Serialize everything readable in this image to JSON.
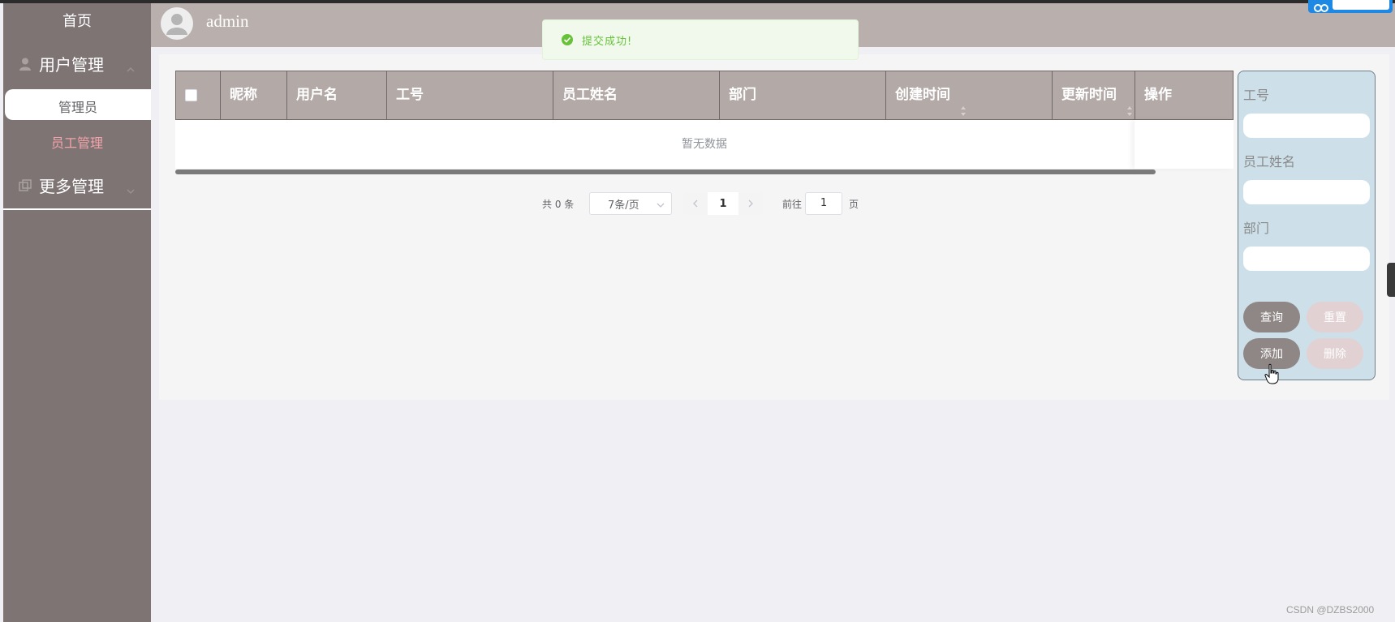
{
  "header": {
    "username": "admin"
  },
  "sidebar": {
    "home": "首页",
    "groups": [
      {
        "label": "用户管理",
        "items": [
          "管理员",
          "员工管理"
        ]
      },
      {
        "label": "更多管理"
      }
    ]
  },
  "toast": {
    "message": "提交成功!"
  },
  "table": {
    "columns": [
      "昵称",
      "用户名",
      "工号",
      "员工姓名",
      "部门",
      "创建时间",
      "更新时间",
      "操作"
    ],
    "empty_text": "暂无数据"
  },
  "pagination": {
    "total": "共 0 条",
    "page_size": "7条/页",
    "current_page": "1",
    "goto_label": "前往",
    "goto_value": "1",
    "goto_unit": "页"
  },
  "search": {
    "labels": [
      "工号",
      "员工姓名",
      "部门"
    ],
    "buttons": {
      "query": "查询",
      "reset": "重置",
      "add": "添加",
      "delete": "删除"
    }
  },
  "watermark": "CSDN @DZBS2000",
  "colors": {
    "sidebar": "#7e7474",
    "header": "#b9afac",
    "table_header": "#b3a9a6",
    "search_panel": "#cde0ea",
    "button_dark": "#8f8686",
    "button_light": "#e1d1d2",
    "active_sub": "#f3a3ab",
    "success": "#67c23a"
  }
}
